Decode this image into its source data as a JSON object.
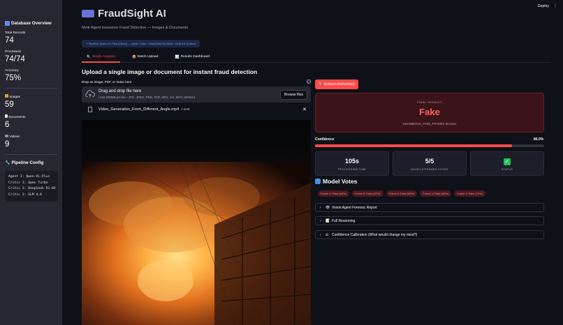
{
  "topbar": {
    "deploy_label": "Deploy",
    "menu_glyph": "⋮"
  },
  "sidebar": {
    "db_header": "Database Overview",
    "metrics": [
      {
        "label": "Total Records",
        "value": "74"
      },
      {
        "label": "Processed",
        "value": "74/74"
      },
      {
        "label": "Accuracy",
        "value": "75%"
      }
    ],
    "media": [
      {
        "label": "Images",
        "value": "59"
      },
      {
        "label": "Documents",
        "value": "6"
      },
      {
        "label": "Videos",
        "value": "9"
      }
    ],
    "pipeline_header": "Pipeline Config",
    "pipeline_lines": [
      "Agent 1: Qwen-VL-Plus",
      "Critic 1: Qwen Turbo",
      "Critic 2: DeepSeek R1-05",
      "Critic 3: GLM 4.6"
    ]
  },
  "header": {
    "title": "FraudSight AI",
    "subtitle": "Multi-Agent Insurance Fraud Detection — Images & Documents",
    "pipeline_pill": "⚡ Pipeline: Qwen-VL-Plus (Vision) → Qwen Turbo • DeepSeek R1-0528 • GLM 4.6 (Critics)"
  },
  "tabs": [
    {
      "label": "Single Analysis",
      "icon": "🔍",
      "active": true
    },
    {
      "label": "Batch Upload",
      "icon": "📦",
      "active": false
    },
    {
      "label": "Results Dashboard",
      "icon": "📊",
      "active": false
    }
  ],
  "upload": {
    "heading": "Upload a single image or document for instant fraud detection",
    "label": "Drop an image, PDF, or Video here",
    "help_glyph": "?",
    "drop_main": "Drag and drop file here",
    "drop_sub": "Limit 200MB per file • JPG, JPEG, PNG, PDF, MP4, AVI, MOV, MPEG4",
    "browse_label": "Browse files",
    "file_name": "Video_Generation_From_Different_Angle.mp4",
    "file_size": "3.6MB",
    "remove_glyph": "✕"
  },
  "analyze_label": "Analyze Authenticity",
  "verdict": {
    "label": "FINAL VERDICT",
    "value": "Fake",
    "decision": "UNANIMOUS_FAKE_FRAMES decision"
  },
  "confidence": {
    "label": "Confidence",
    "value_text": "86.0%",
    "fraction": 0.86
  },
  "stats": [
    {
      "value": "105s",
      "label": "PROCESSING TIME"
    },
    {
      "value": "5/5",
      "label": "MODELS/FRAMES VOTES"
    },
    {
      "value": "✓",
      "label": "STATUS"
    }
  ],
  "model_votes": {
    "heading": "Model Votes",
    "votes": [
      "Frame 1: Fake (60%)",
      "Frame 2: Fake (87%)",
      "Frame 3: Fake (60%)",
      "Frame 4: Fake (60%)",
      "Frame 5: Fake (70%)"
    ]
  },
  "expanders": [
    {
      "label": "Vision Agent Forensic Report",
      "icon": "👁"
    },
    {
      "label": "Full Reasoning",
      "icon": "📝"
    },
    {
      "label": "Confidence Calibration (What would change my mind?)",
      "icon": "⚖"
    }
  ],
  "colors": {
    "accent": "#ff4b4b",
    "verdict_bg": "#3a1418",
    "sidebar_bg": "#262730",
    "page_bg": "#0e1117"
  }
}
